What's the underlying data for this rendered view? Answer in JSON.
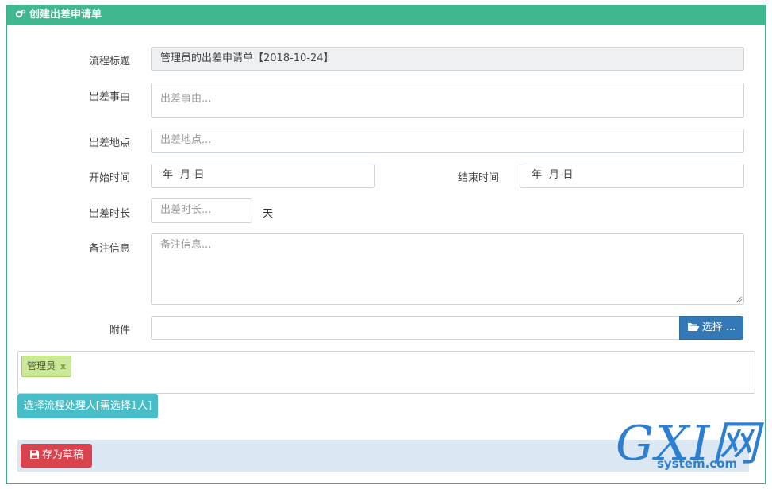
{
  "header": {
    "title": "创建出差申请单"
  },
  "form": {
    "title_label": "流程标题",
    "title_value": "管理员的出差申请单【2018-10-24】",
    "reason_label": "出差事由",
    "reason_placeholder": "出差事由...",
    "place_label": "出差地点",
    "place_placeholder": "出差地点...",
    "start_label": "开始时间",
    "start_value": "年 -月-日",
    "end_label": "结束时间",
    "end_value": "年 -月-日",
    "duration_label": "出差时长",
    "duration_placeholder": "出差时长...",
    "duration_unit": "天",
    "remark_label": "备注信息",
    "remark_placeholder": "备注信息...",
    "attach_label": "附件",
    "attach_button": "选择 ..."
  },
  "handlers": {
    "tags": [
      "管理员"
    ],
    "remove_symbol": "x",
    "select_button": "选择流程处理人[需选择1人]"
  },
  "footer": {
    "draft_button": "存为草稿"
  },
  "watermark": {
    "logo": "GXI网",
    "site": "system.com"
  },
  "colors": {
    "header": "#3fb890",
    "primary": "#3379b7",
    "info": "#48bcc7",
    "danger": "#d9434e",
    "tag": "#cbe79a"
  }
}
